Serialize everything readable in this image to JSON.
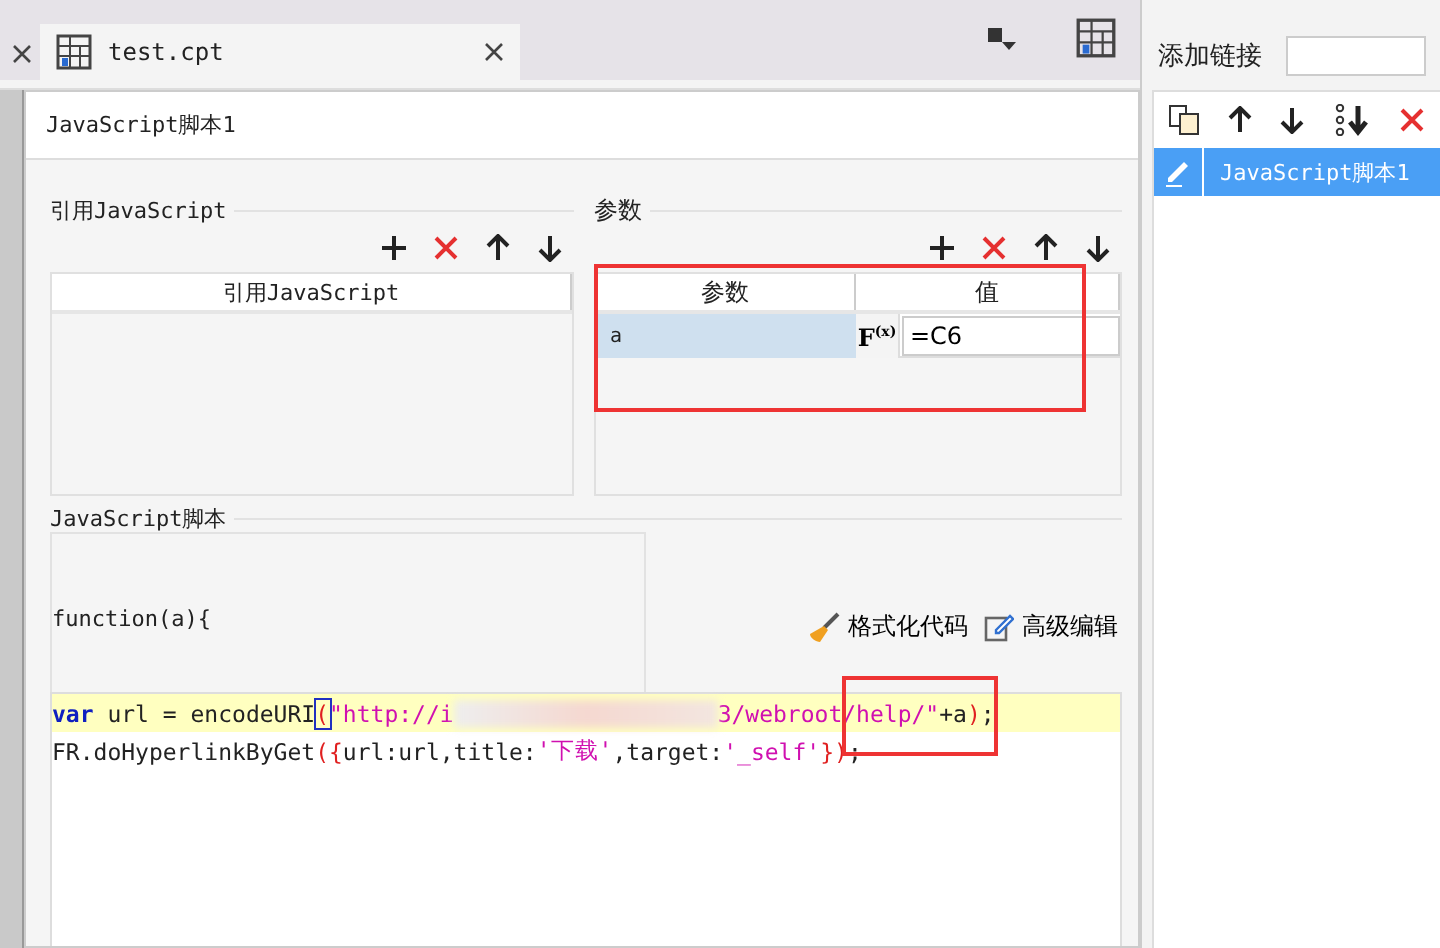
{
  "editor_tabs": [
    {
      "label": "test.cpt",
      "selected": true
    }
  ],
  "side_panel": {
    "add_link_label": "添加链接",
    "links": [
      {
        "label": "JavaScript脚本1",
        "selected": true
      }
    ]
  },
  "dialog": {
    "title": "JavaScript脚本1",
    "references": {
      "legend": "引用JavaScript",
      "columns": [
        "引用JavaScript"
      ]
    },
    "parameters": {
      "legend": "参数",
      "columns": [
        "参数",
        "值"
      ],
      "rows": [
        {
          "name": "a",
          "formula_label": "F$^{(x)}$",
          "value": "=C6",
          "selected": true
        }
      ]
    },
    "script": {
      "legend": "JavaScript脚本",
      "header": "function(a){",
      "format_button": "格式化代码",
      "advanced_button": "高级编辑",
      "lines": [
        {
          "highlighted": true,
          "tokens": [
            {
              "kind": "keyword",
              "text": "var"
            },
            {
              "kind": "plain",
              "text": " url = encodeURI"
            },
            {
              "kind": "bracket",
              "text": "(",
              "matched": true
            },
            {
              "kind": "string",
              "text": "\"http://i"
            },
            {
              "kind": "blur"
            },
            {
              "kind": "string",
              "text": "3/webroot/help/\""
            },
            {
              "kind": "plain",
              "text": "+a"
            },
            {
              "kind": "bracket",
              "text": ")",
              "matched": false
            },
            {
              "kind": "plain",
              "text": ";"
            }
          ]
        },
        {
          "highlighted": false,
          "tokens": [
            {
              "kind": "plain",
              "text": "FR.doHyperlinkByGet"
            },
            {
              "kind": "bracket",
              "text": "({",
              "matched": false
            },
            {
              "kind": "plain",
              "text": "url:url,title:"
            },
            {
              "kind": "string",
              "text": "'下载'"
            },
            {
              "kind": "plain",
              "text": ",target:"
            },
            {
              "kind": "string",
              "text": "'_self'"
            },
            {
              "kind": "bracket",
              "text": "})",
              "matched": false
            },
            {
              "kind": "plain",
              "text": ";"
            }
          ]
        }
      ]
    }
  },
  "annotations": [
    {
      "kind": "frame"
    },
    {
      "kind": "frame"
    }
  ]
}
